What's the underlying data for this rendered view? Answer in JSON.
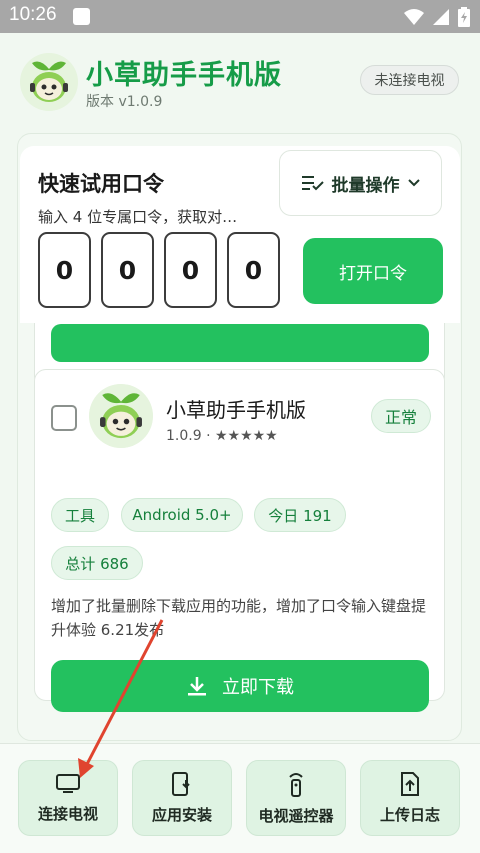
{
  "statusbar": {
    "time": "10:26"
  },
  "header": {
    "title": "小草助手手机版",
    "version": "版本 v1.0.9",
    "connection_status": "未连接电视"
  },
  "quick": {
    "title": "快速试用口令",
    "subtitle": "输入 4 位专属口令，获取对…",
    "batch_label": "批量操作",
    "digits": [
      "0",
      "0",
      "0",
      "0"
    ],
    "open_label": "打开口令"
  },
  "app_card": {
    "name": "小草助手手机版",
    "meta": "1.0.9 · ★★★★★",
    "status": "正常",
    "tags": [
      "工具",
      "Android 5.0+",
      "今日 191",
      "总计 686"
    ],
    "description": "增加了批量删除下载应用的功能，增加了口令输入键盘提升体验 6.21发布",
    "download_label": "立即下载"
  },
  "bottom_nav": [
    {
      "label": "连接电视",
      "icon": "tv-icon"
    },
    {
      "label": "应用安装",
      "icon": "phone-install-icon"
    },
    {
      "label": "电视遥控器",
      "icon": "remote-icon"
    },
    {
      "label": "上传日志",
      "icon": "upload-file-icon"
    }
  ],
  "colors": {
    "accent": "#23c15f",
    "title_green": "#169c48",
    "annotation_arrow": "#e0442f"
  }
}
